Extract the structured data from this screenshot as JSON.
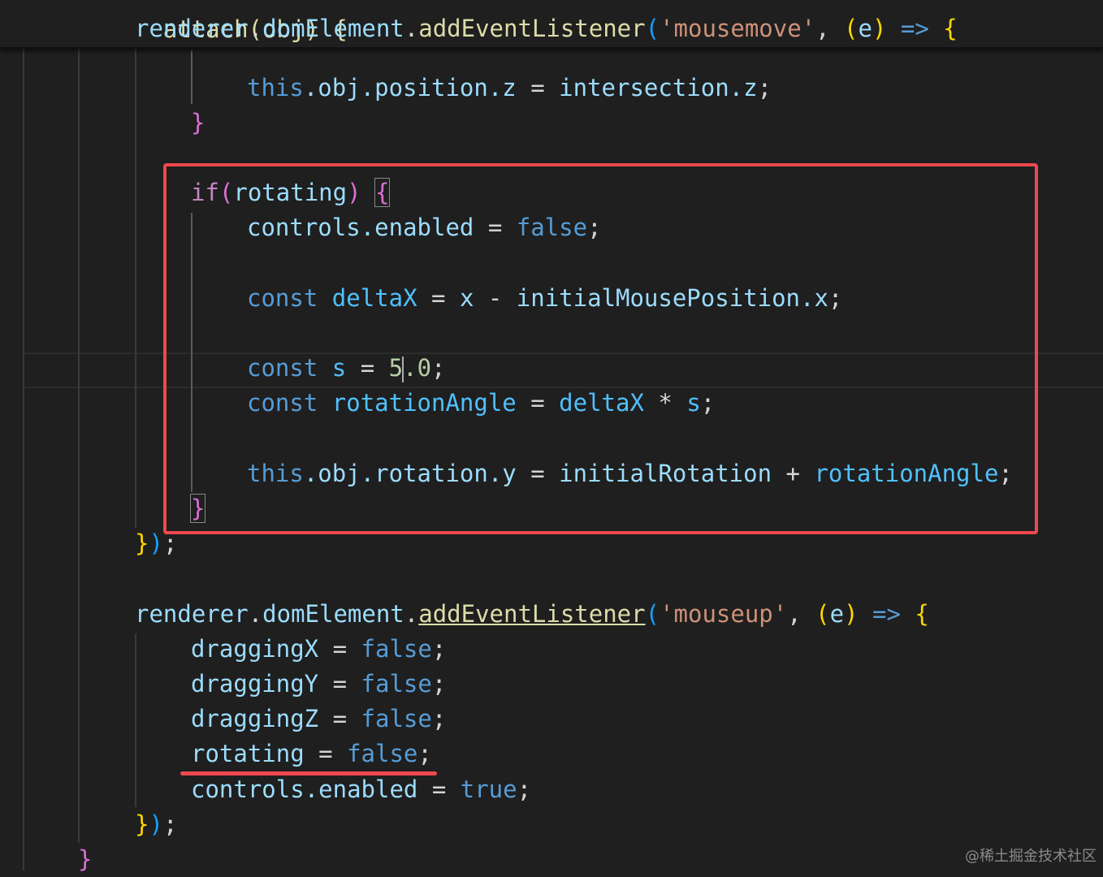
{
  "editor": {
    "sticky_header": {
      "l0": "attach(obj) {",
      "l1": {
        "recv": "renderer",
        "dot1": ".",
        "prop": "domElement",
        "dot2": ".",
        "method": "addEventListener",
        "open": "(",
        "event": "'mousemove'",
        "comma": ", ",
        "p_open": "(",
        "param": "e",
        "p_close": ")",
        "arrow": " => ",
        "brace": "{"
      }
    },
    "lines": {
      "l2": {
        "this": "this",
        "rest1": ".obj.position.z",
        "eq": " = ",
        "rhs": "intersection",
        "rhs2": ".z",
        "semi": ";"
      },
      "l3": {
        "brace": "}"
      },
      "l4": {
        "kw": "if",
        "open": "(",
        "cond": "rotating",
        "close": ")",
        "brace": "{"
      },
      "l5": {
        "obj": "controls",
        "prop": ".enabled",
        "eq": " = ",
        "val": "false",
        "semi": ";"
      },
      "l6": {
        "kw": "const",
        "name": "deltaX",
        "eq": " = ",
        "a": "x",
        "op": " - ",
        "b": "initialMousePosition",
        "b2": ".x",
        "semi": ";"
      },
      "l7": {
        "kw": "const",
        "name": "s",
        "eq": " = ",
        "num_a": "5",
        "num_b": ".0",
        "semi": ";"
      },
      "l8": {
        "kw": "const",
        "name": "rotationAngle",
        "eq": " = ",
        "a": "deltaX",
        "op": " * ",
        "b": "s",
        "semi": ";"
      },
      "l9": {
        "this": "this",
        "rest1": ".obj.rotation.y",
        "eq": " = ",
        "a": "initialRotation",
        "op": " + ",
        "b": "rotationAngle",
        "semi": ";"
      },
      "l10": {
        "brace": "}"
      },
      "l11": {
        "brace": "}",
        "paren": ")",
        "semi": ";"
      },
      "l12": {
        "recv": "renderer",
        "dot1": ".",
        "prop": "domElement",
        "dot2": ".",
        "method": "addEventListener",
        "open": "(",
        "event": "'mouseup'",
        "comma": ", ",
        "p_open": "(",
        "param": "e",
        "p_close": ")",
        "arrow": " => ",
        "brace": "{"
      },
      "l13": {
        "name": "draggingX",
        "eq": " = ",
        "val": "false",
        "semi": ";"
      },
      "l14": {
        "name": "draggingY",
        "eq": " = ",
        "val": "false",
        "semi": ";"
      },
      "l15": {
        "name": "draggingZ",
        "eq": " = ",
        "val": "false",
        "semi": ";"
      },
      "l16": {
        "name": "rotating",
        "eq": " = ",
        "val": "false",
        "semi": ";"
      },
      "l17": {
        "obj": "controls",
        "prop": ".enabled",
        "eq": " = ",
        "val": "true",
        "semi": ";"
      },
      "l18": {
        "brace": "}",
        "paren": ")",
        "semi": ";"
      },
      "l19": {
        "brace": "}"
      }
    }
  },
  "annotations": {
    "box_color": "#f0484f",
    "underline_color": "#f0484f"
  },
  "watermark": "@稀土掘金技术社区"
}
